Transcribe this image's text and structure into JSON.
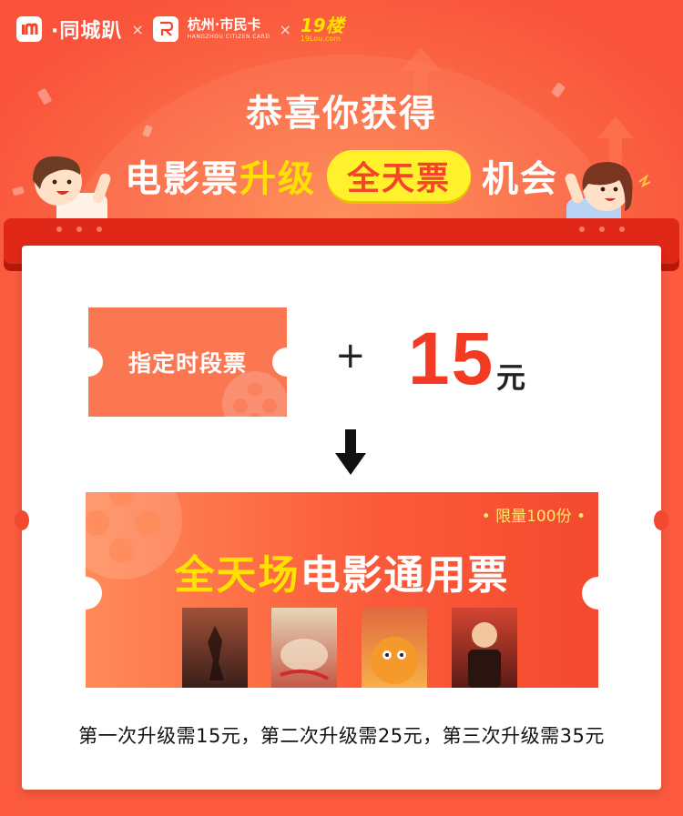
{
  "logos": {
    "tongcheng_text": "·同城趴",
    "separator": "×",
    "citizen_card_text": "杭州·市民卡",
    "citizen_card_sub": "HANGZHOU CITIZEN CARD",
    "lou_text": "19楼",
    "lou_sub": "19Lou.com"
  },
  "headline": {
    "line1": "恭喜你获得",
    "line2_part1": "电影票",
    "line2_highlight": "升级",
    "line2_pill": "全天票",
    "line2_part3": "机会"
  },
  "offer": {
    "small_ticket_label": "指定时段票",
    "plus": "+",
    "price": "15",
    "price_unit": "元"
  },
  "result": {
    "limit": "• 限量100份 •",
    "title_highlight": "全天场",
    "title_rest": "电影通用票",
    "posters": [
      {
        "title": "",
        "color_top": "#8a3a2a",
        "color_bottom": "#3b1f1a"
      },
      {
        "title": "",
        "color_top": "#d9c7a8",
        "color_bottom": "#b84a3a"
      },
      {
        "title": "",
        "color_top": "#d8623a",
        "color_bottom": "#f4a23a"
      },
      {
        "title": "",
        "color_top": "#c23a2a",
        "color_bottom": "#5a1a14"
      }
    ]
  },
  "footnote": "第一次升级需15元，第二次升级需25元，第三次升级需35元",
  "colors": {
    "background": "#fb5a3e",
    "accent_yellow": "#ffe100",
    "price_red": "#f33a22",
    "ticket_orange": "#fa7752"
  }
}
